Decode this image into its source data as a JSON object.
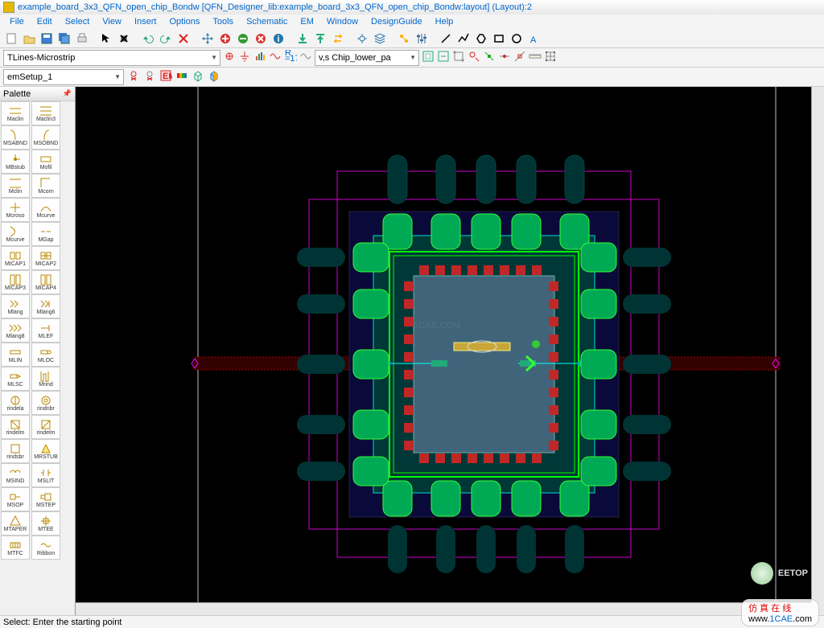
{
  "title": "example_board_3x3_QFN_open_chip_Bondw [QFN_Designer_lib:example_board_3x3_QFN_open_chip_Bondw:layout] (Layout):2",
  "menu": {
    "file": "File",
    "edit": "Edit",
    "select": "Select",
    "view": "View",
    "insert": "Insert",
    "options": "Options",
    "tools": "Tools",
    "schematic": "Schematic",
    "em": "EM",
    "window": "Window",
    "designguide": "DesignGuide",
    "help": "Help"
  },
  "toolbar3": {
    "library_dd": "TLines-Microstrip",
    "layer_dd": "v,s Chip_lower_pa"
  },
  "toolbar4": {
    "em_dd": "emSetup_1"
  },
  "palette": {
    "header": "Palette",
    "items": [
      [
        "Maclin",
        "Maclin3"
      ],
      [
        "MSABND",
        "MSOBND"
      ],
      [
        "MBstub",
        "Mofil"
      ],
      [
        "Mclin",
        "Mcorn"
      ],
      [
        "Mcroso",
        "Mcurve"
      ],
      [
        "Mcurve",
        "MGap"
      ],
      [
        "MICAP1",
        "MICAP2"
      ],
      [
        "MICAP3",
        "MICAP4"
      ],
      [
        "Mlang",
        "Mlang6"
      ],
      [
        "Mlang8",
        "MLEF"
      ],
      [
        "MLIN",
        "MLOC"
      ],
      [
        "MLSC",
        "Mrind"
      ],
      [
        "rindela",
        "rindnbr"
      ],
      [
        "rindelm",
        "rindelm"
      ],
      [
        "rindsbr",
        "MRSTUB"
      ],
      [
        "MSIND",
        "MSLIT"
      ],
      [
        "MSOP",
        "MSTEP"
      ],
      [
        "MTAPER",
        "MTEE"
      ],
      [
        "MTFC",
        "Ribbon"
      ]
    ]
  },
  "status": "Select: Enter the starting point",
  "watermark": {
    "eetop": "EETOP",
    "sim_cn": "仿 真 在 线",
    "cae_w": "www.",
    "cae_1": "1CAE",
    "cae_c": ".com"
  }
}
